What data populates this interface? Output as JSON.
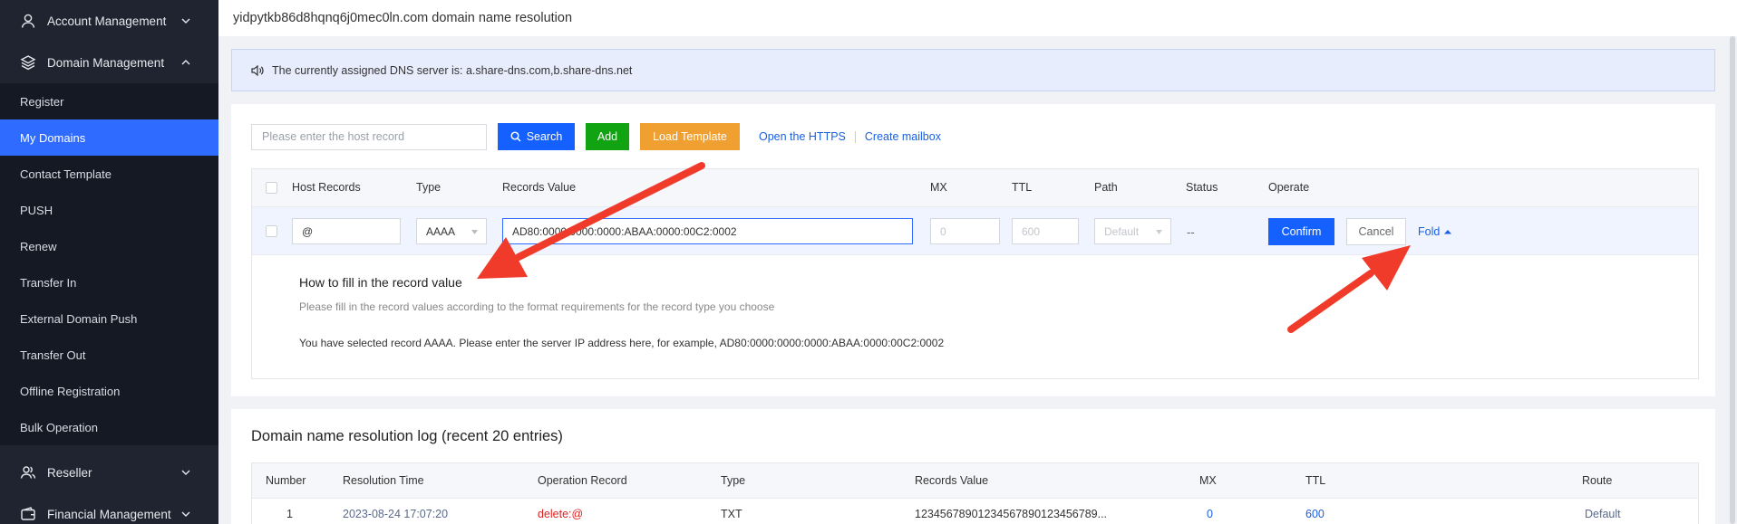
{
  "sidebar": {
    "account": "Account Management",
    "domain": "Domain Management",
    "items": [
      "Register",
      "My Domains",
      "Contact Template",
      "PUSH",
      "Renew",
      "Transfer In",
      "External Domain Push",
      "Transfer Out",
      "Offline Registration",
      "Bulk Operation"
    ],
    "reseller": "Reseller",
    "financial": "Financial Management"
  },
  "header": {
    "title": "yidpytkb86d8hqnq6j0mec0ln.com domain name resolution"
  },
  "notice": {
    "text": "The currently assigned DNS server is: a.share-dns.com,b.share-dns.net"
  },
  "toolbar": {
    "search_placeholder": "Please enter the host record",
    "search_label": "Search",
    "add_label": "Add",
    "template_label": "Load Template",
    "https_link": "Open the HTTPS",
    "mailbox_link": "Create mailbox"
  },
  "records": {
    "columns": [
      "Host Records",
      "Type",
      "Records Value",
      "MX",
      "TTL",
      "Path",
      "Status",
      "Operate"
    ],
    "row": {
      "host": "@",
      "type": "AAAA",
      "value": "AD80:0000:0000:0000:ABAA:0000:00C2:0002",
      "mx": "0",
      "ttl": "600",
      "path": "Default",
      "status": "--",
      "confirm": "Confirm",
      "cancel": "Cancel",
      "fold": "Fold"
    },
    "help": {
      "title": "How to fill in the record value",
      "desc": "Please fill in the record values according to the format requirements for the record type you choose",
      "example": "You have selected record AAAA. Please enter the server IP address here, for example, AD80:0000:0000:0000:ABAA:0000:00C2:0002"
    }
  },
  "log": {
    "title": "Domain name resolution log (recent 20 entries)",
    "columns": [
      "Number",
      "Resolution Time",
      "Operation Record",
      "Type",
      "Records Value",
      "MX",
      "TTL",
      "Route"
    ],
    "rows": [
      {
        "number": "1",
        "time": "2023-08-24 17:07:20",
        "operation": "delete:@",
        "type": "TXT",
        "value": "12345678901234567890123456789...",
        "mx": "0",
        "ttl": "600",
        "route": "Default"
      }
    ]
  },
  "colors": {
    "accent": "#1461ff",
    "add": "#12a312",
    "template": "#f0a030",
    "sidebar_bg": "#1f2430",
    "active_item": "#2f6bff",
    "link": "#1a5fe0",
    "delete": "#e02020",
    "arrow": "#f03a2a"
  },
  "icons": {
    "account": "user-icon",
    "domain": "layers-icon",
    "reseller": "users-icon",
    "financial": "wallet-icon",
    "notice": "speaker-icon",
    "search": "search-icon"
  }
}
